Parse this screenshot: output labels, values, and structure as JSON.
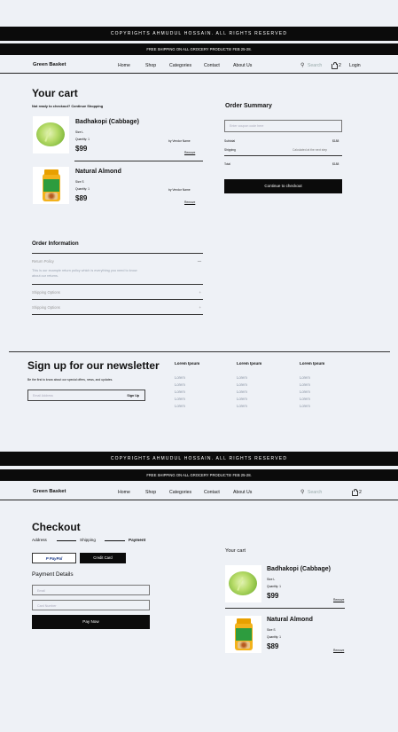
{
  "topbar": {
    "copyright": "COPYRIGHTS AHMUDUL HOSSAIN. ALL RIGHTS RESERVED",
    "shipping": "FREE SHIPPING ON ALL GROCERY PRODUCTS! FEB 25-28."
  },
  "nav": {
    "brand": "Green Basket",
    "links": [
      "Home",
      "Shop",
      "Categories",
      "Contact",
      "About Us"
    ],
    "search_placeholder": "Search",
    "cart_count": "2",
    "login": "Login"
  },
  "cart": {
    "title": "Your cart",
    "subtitle": "Not ready to checkout? Continue Shopping",
    "items": [
      {
        "name": "Badhakopi (Cabbage)",
        "size": "Size L",
        "quantity": "Quantity: 1",
        "price": "$99",
        "vendor": "by Vendor Name",
        "remove": "Remove"
      },
      {
        "name": "Natural Almond",
        "size": "Size S",
        "quantity": "Quantity: 1",
        "price": "$89",
        "vendor": "by Vendor Name",
        "remove": "Remove"
      }
    ]
  },
  "summary": {
    "title": "Order Summary",
    "coupon_placeholder": "Enter coupon code here",
    "subtotal_label": "Subtotal",
    "subtotal_value": "$188",
    "shipping_label": "Shipping",
    "shipping_value": "Calculated at the next step",
    "total_label": "Total",
    "total_value": "$188",
    "checkout_button": "Continue to checkout"
  },
  "order_info": {
    "title": "Order Information",
    "return_title": "Return Policy",
    "return_text_1": "This is our example return policy which is everything you need to know",
    "return_text_2": "about our returns.",
    "shipping_options_1": "Shipping Options",
    "shipping_options_2": "Shipping Options",
    "minus": "—",
    "plus": "+"
  },
  "newsletter": {
    "title": "Sign up for our newsletter",
    "text": "Be the first to know about our special offers, news, and updates.",
    "email_placeholder": "Email Address",
    "signup": "Sign Up",
    "columns": [
      {
        "heading": "Lorem Ipsum",
        "items": [
          "Lorem",
          "Lorem",
          "Lorem",
          "Lorem",
          "Lorem"
        ]
      },
      {
        "heading": "Lorem Ipsum",
        "items": [
          "Lorem",
          "Lorem",
          "Lorem",
          "Lorem",
          "Lorem"
        ]
      },
      {
        "heading": "Lorem Ipsum",
        "items": [
          "Lorem",
          "Lorem",
          "Lorem",
          "Lorem",
          "Lorem"
        ]
      }
    ]
  },
  "checkout": {
    "title": "Checkout",
    "steps": [
      "Address",
      "Shipping",
      "Payment"
    ],
    "paypal": "PayPal",
    "credit_card": "Credit Card",
    "payment_details": "Payment Details",
    "email_placeholder": "Email",
    "card_placeholder": "Card Number",
    "pay_now": "Pay Now",
    "your_cart": "Your cart"
  }
}
